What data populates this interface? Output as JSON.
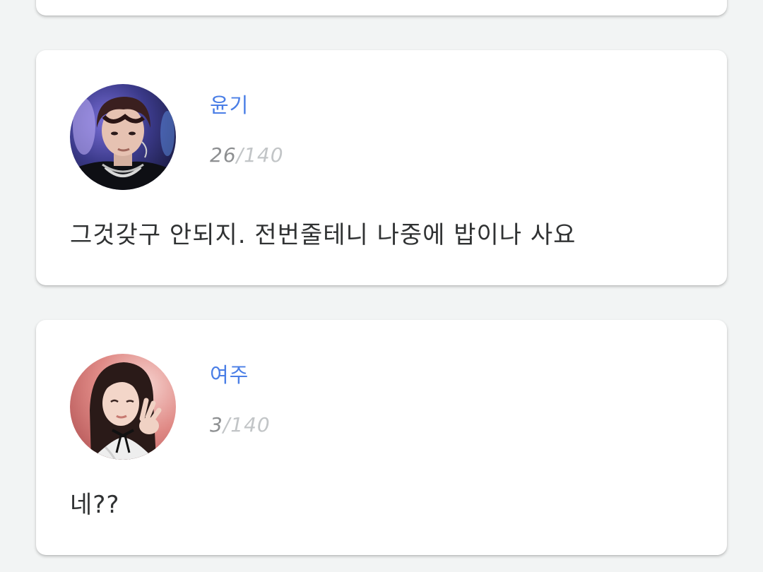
{
  "messages": [
    {
      "name": "윤기",
      "count": "26",
      "separator": "/",
      "max": "140",
      "text": "그것갖구 안되지. 전번줄테니 나중에 밥이나 사요"
    },
    {
      "name": "여주",
      "count": "3",
      "separator": "/",
      "max": "140",
      "text": "네??"
    }
  ],
  "colors": {
    "name": "#4a7ee6",
    "count": "#8d8f91",
    "max": "#c2c5c7",
    "text": "#303233",
    "background": "#f2f4f4",
    "card": "#ffffff"
  }
}
